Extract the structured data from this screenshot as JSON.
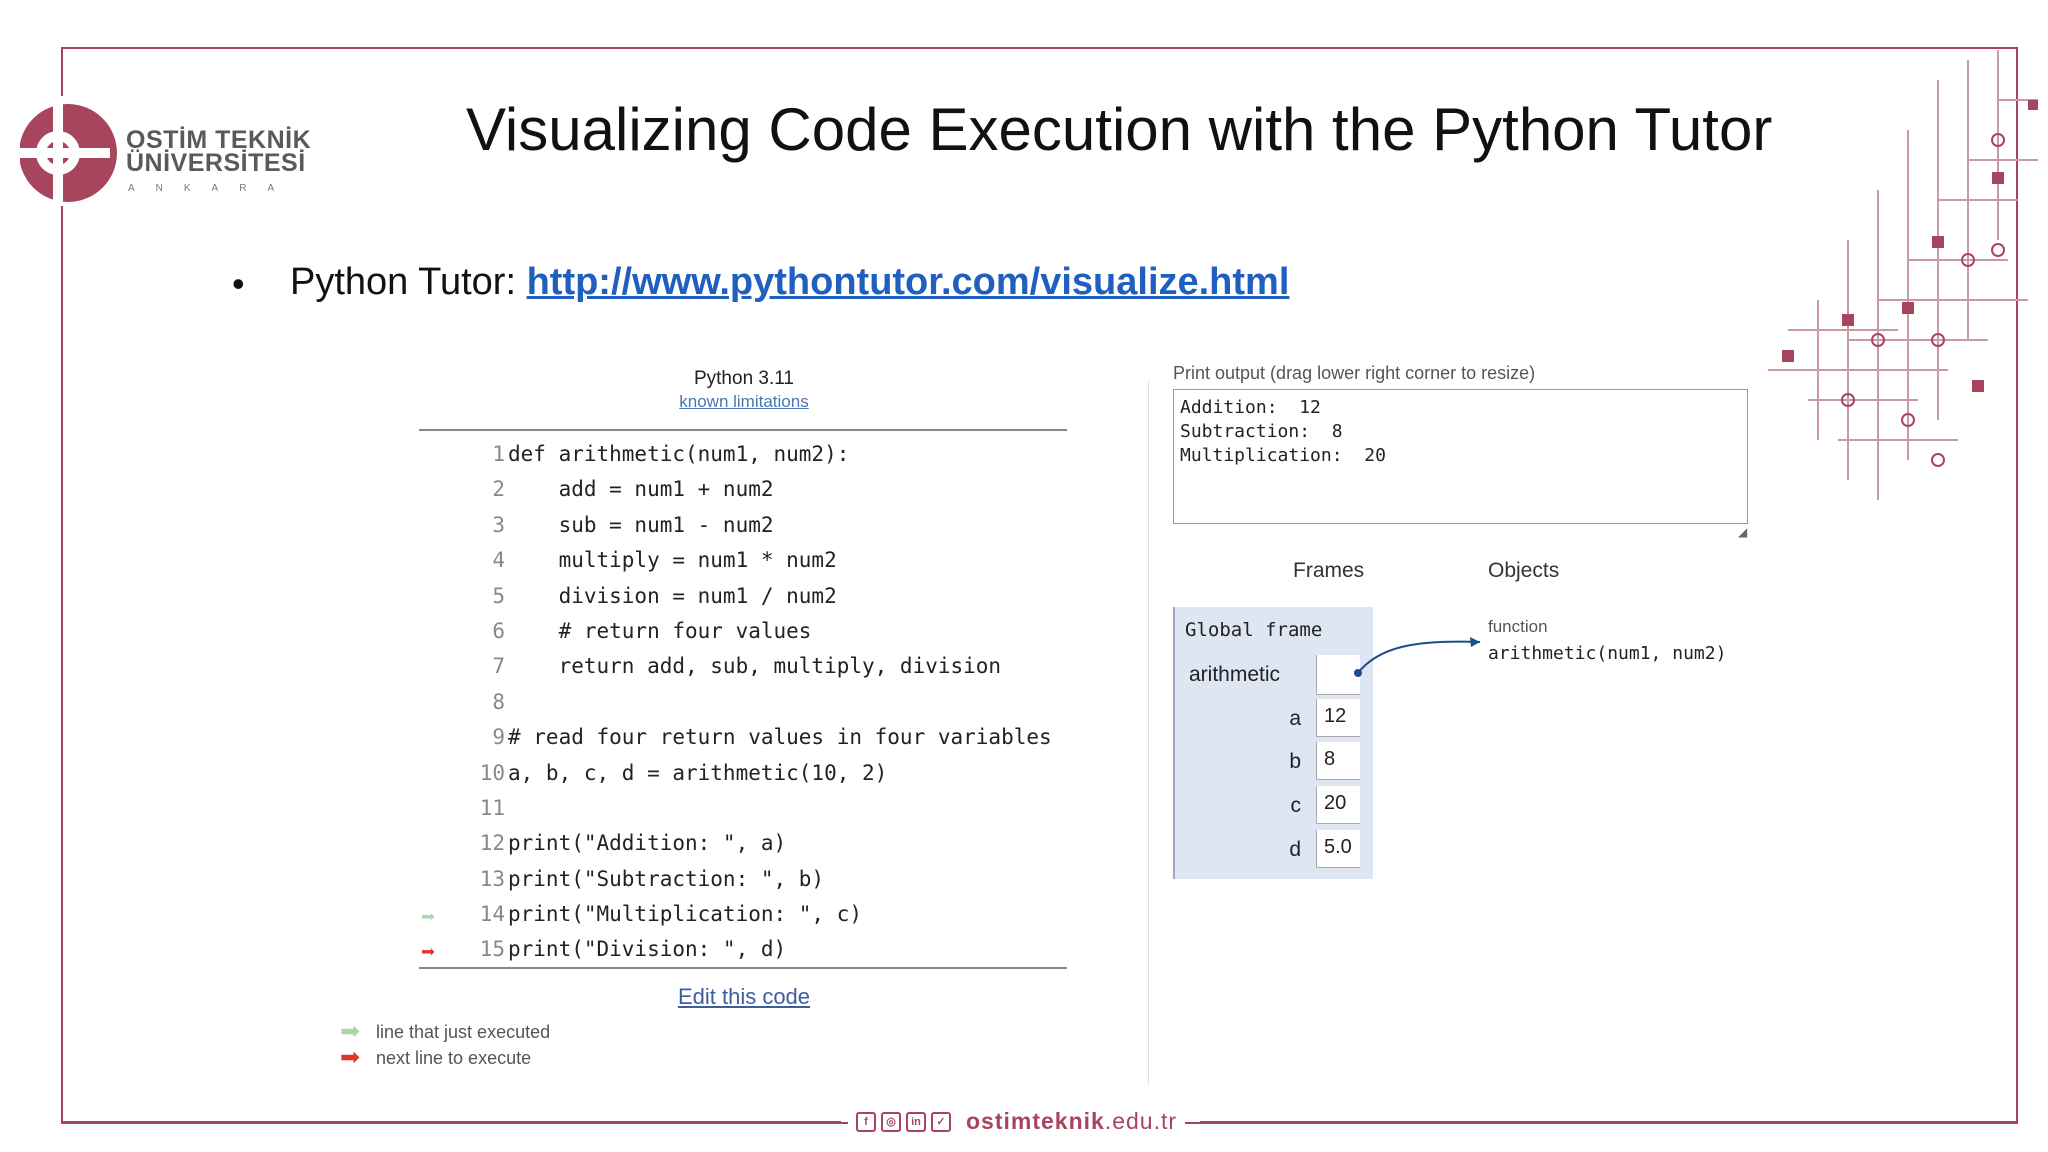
{
  "slide": {
    "title": "Visualizing Code Execution with the Python Tutor",
    "bullet": "•",
    "bullet_prefix": "Python Tutor: ",
    "bullet_link": "http://www.pythontutor.com/visualize.html"
  },
  "logo": {
    "line1": "OSTİM TEKNİK",
    "line2": "ÜNİVERSİTESİ",
    "city": "ANKARA"
  },
  "tutor": {
    "version": "Python 3.11",
    "known_limitations": "known limitations",
    "edit_code": "Edit this code",
    "legend_executed": "line that just executed",
    "legend_next": "next line to execute",
    "arrow_glyph": "➡",
    "lines": [
      {
        "n": "1",
        "code": "def arithmetic(num1, num2):"
      },
      {
        "n": "2",
        "code": "    add = num1 + num2"
      },
      {
        "n": "3",
        "code": "    sub = num1 - num2"
      },
      {
        "n": "4",
        "code": "    multiply = num1 * num2"
      },
      {
        "n": "5",
        "code": "    division = num1 / num2"
      },
      {
        "n": "6",
        "code": "    # return four values"
      },
      {
        "n": "7",
        "code": "    return add, sub, multiply, division"
      },
      {
        "n": "8",
        "code": ""
      },
      {
        "n": "9",
        "code": "# read four return values in four variables"
      },
      {
        "n": "10",
        "code": "a, b, c, d = arithmetic(10, 2)"
      },
      {
        "n": "11",
        "code": ""
      },
      {
        "n": "12",
        "code": "print(\"Addition: \", a)"
      },
      {
        "n": "13",
        "code": "print(\"Subtraction: \", b)"
      },
      {
        "n": "14",
        "code": "print(\"Multiplication: \", c)"
      },
      {
        "n": "15",
        "code": "print(\"Division: \", d)"
      }
    ]
  },
  "output": {
    "label": "Print output (drag lower right corner to resize)",
    "text": "Addition:  12\nSubtraction:  8\nMultiplication:  20"
  },
  "viz": {
    "frames_header": "Frames",
    "objects_header": "Objects",
    "global_frame": "Global frame",
    "function_var": "arithmetic",
    "vars": [
      {
        "name": "a",
        "value": "12"
      },
      {
        "name": "b",
        "value": "8"
      },
      {
        "name": "c",
        "value": "20"
      },
      {
        "name": "d",
        "value": "5.0"
      }
    ],
    "func_label": "function",
    "func_sig": "arithmetic(num1, num2)"
  },
  "footer": {
    "social": [
      "f",
      "◎",
      "in",
      "✓"
    ],
    "site_bold": "ostimteknik",
    "site_rest": ".edu.tr"
  },
  "colors": {
    "brand": "#a8455e",
    "link": "#1f5fbf",
    "green_arrow": "#a8d8a8",
    "red_arrow": "#e0362a",
    "frame_bg": "#dde6f2"
  }
}
